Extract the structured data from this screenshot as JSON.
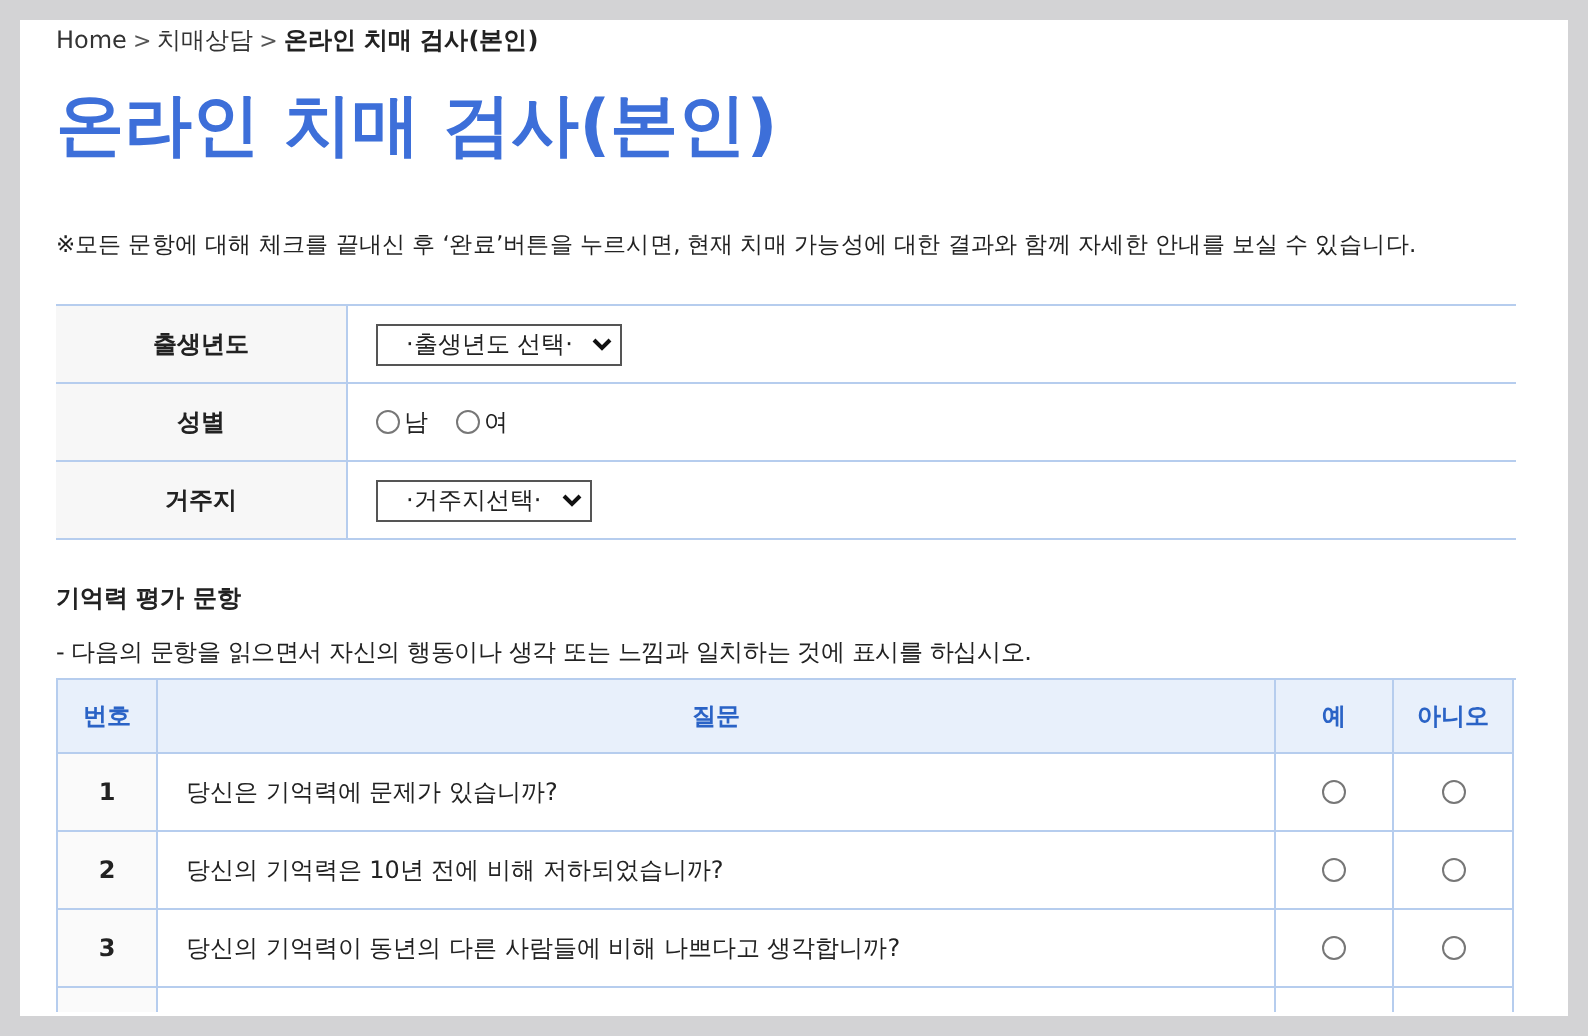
{
  "breadcrumb": [
    {
      "label": "Home",
      "current": false
    },
    {
      "label": "치매상담",
      "current": false
    },
    {
      "label": "온라인 치매 검사(본인)",
      "current": true
    }
  ],
  "breadcrumb_separator": ">",
  "page_title": "온라인 치매 검사(본인)",
  "notice": "※모든 문항에 대해 체크를 끝내신 후 ‘완료’버튼을 누르시면, 현재 치매 가능성에 대한 결과와 함께 자세한 안내를 보실 수 있습니다.",
  "info_form": [
    {
      "kind": "select",
      "label": "출생년도",
      "value": "·출생년도 선택·"
    },
    {
      "kind": "radio",
      "label": "성별",
      "options": [
        {
          "label": "남",
          "selected": false
        },
        {
          "label": "여",
          "selected": false
        }
      ]
    },
    {
      "kind": "select",
      "label": "거주지",
      "value": "·거주지선택·"
    }
  ],
  "section_title": "기억력 평가 문항",
  "section_description": "- 다음의 문항을 읽으면서 자신의 행동이나 생각 또는 느낌과 일치하는 것에 표시를 하십시오.",
  "table": {
    "columns": [
      "번호",
      "질문",
      "예",
      "아니오"
    ],
    "rows": [
      {
        "number": "1",
        "question": "당신은 기억력에 문제가 있습니까?",
        "answers": [
          {
            "selected": false
          },
          {
            "selected": false
          }
        ]
      },
      {
        "number": "2",
        "question": "당신의 기억력은 10년 전에 비해 저하되었습니까?",
        "answers": [
          {
            "selected": false
          },
          {
            "selected": false
          }
        ]
      },
      {
        "number": "3",
        "question": "당신의 기억력이 동년의 다른 사람들에 비해 나쁘다고 생각합니까?",
        "answers": [
          {
            "selected": false
          },
          {
            "selected": false
          }
        ]
      }
    ]
  }
}
